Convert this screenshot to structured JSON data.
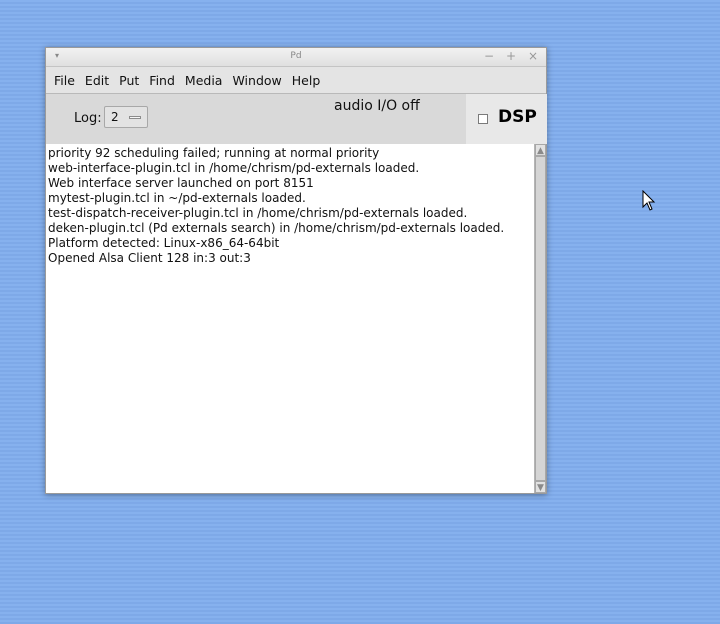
{
  "window": {
    "title": "Pd",
    "menu_glyph": "▾",
    "minimize_glyph": "−",
    "maximize_glyph": "+",
    "close_glyph": "×"
  },
  "menubar": {
    "items": [
      "File",
      "Edit",
      "Put",
      "Find",
      "Media",
      "Window",
      "Help"
    ]
  },
  "toolbar": {
    "log_label": "Log:",
    "log_value": "2",
    "audio_status": "audio I/O off",
    "dsp_label": "DSP",
    "dsp_checked": false
  },
  "console": {
    "lines": [
      "priority 92 scheduling failed; running at normal priority",
      "web-interface-plugin.tcl in /home/chrism/pd-externals loaded.",
      "Web interface server launched on port 8151",
      "mytest-plugin.tcl in ~/pd-externals loaded.",
      "test-dispatch-receiver-plugin.tcl in /home/chrism/pd-externals loaded.",
      "deken-plugin.tcl (Pd externals search) in /home/chrism/pd-externals loaded.",
      "Platform detected: Linux-x86_64-64bit",
      "Opened Alsa Client 128 in:3 out:3"
    ]
  },
  "scrollbar": {
    "up_glyph": "▲",
    "down_glyph": "▼"
  },
  "icons": {
    "window_menu": "window-menu-icon",
    "minimize": "minimize-icon",
    "maximize": "maximize-icon",
    "close": "close-icon",
    "cursor": "mouse-pointer-icon"
  },
  "colors": {
    "desktop": "#86b1ee",
    "window_bg": "#d9d9d9",
    "console_bg": "#ffffff"
  }
}
